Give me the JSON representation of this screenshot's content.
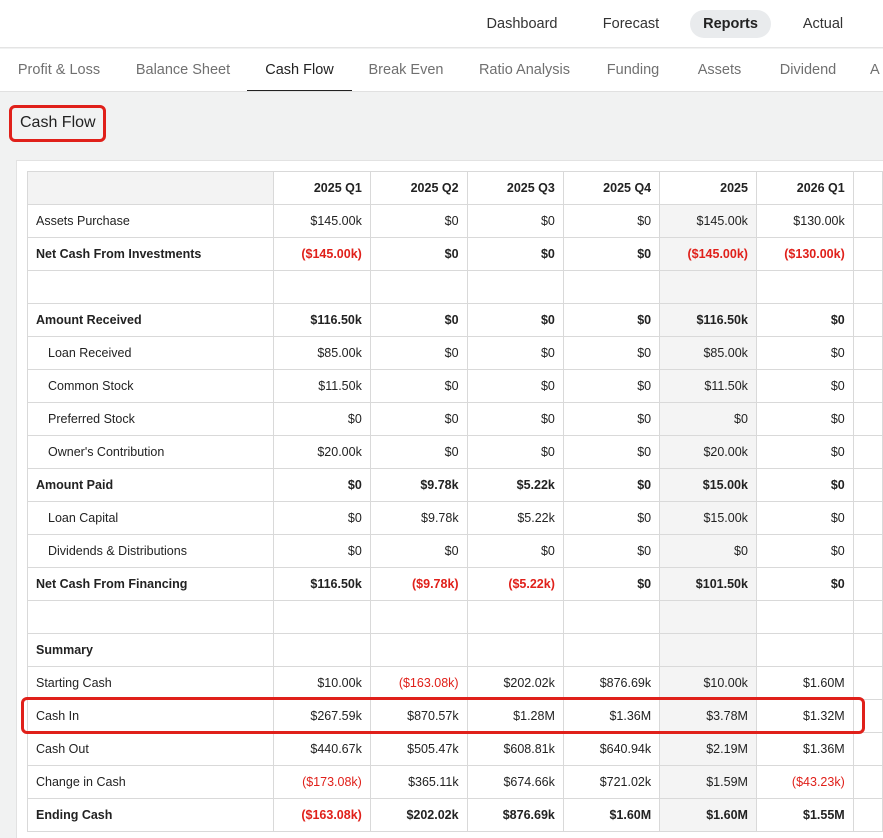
{
  "topnav": {
    "items": [
      {
        "label": "Dashboard",
        "active": false
      },
      {
        "label": "Forecast",
        "active": false
      },
      {
        "label": "Reports",
        "active": true
      },
      {
        "label": "Actual",
        "active": false
      }
    ]
  },
  "subtabs": {
    "items": [
      {
        "label": "Profit & Loss",
        "active": false
      },
      {
        "label": "Balance Sheet",
        "active": false
      },
      {
        "label": "Cash Flow",
        "active": true
      },
      {
        "label": "Break Even",
        "active": false
      },
      {
        "label": "Ratio Analysis",
        "active": false
      },
      {
        "label": "Funding",
        "active": false
      },
      {
        "label": "Assets",
        "active": false
      },
      {
        "label": "Dividend",
        "active": false
      },
      {
        "label": "A",
        "active": false
      }
    ]
  },
  "page": {
    "title": "Cash Flow"
  },
  "colors": {
    "negative": "#e0201a",
    "highlight": "#e0201a",
    "active_pill": "#e9ebed"
  },
  "table": {
    "headers": [
      "",
      "2025 Q1",
      "2025 Q2",
      "2025 Q3",
      "2025 Q4",
      "2025",
      "2026 Q1",
      ""
    ],
    "rows": [
      {
        "label": "Assets Purchase",
        "bold": false,
        "sub": false,
        "values": [
          "$145.00k",
          "$0",
          "$0",
          "$0",
          "$145.00k",
          "$130.00k"
        ],
        "neg": []
      },
      {
        "label": "Net Cash From Investments",
        "bold": true,
        "sub": false,
        "values": [
          "($145.00k)",
          "$0",
          "$0",
          "$0",
          "($145.00k)",
          "($130.00k)"
        ],
        "neg": [
          0,
          4,
          5
        ]
      },
      {
        "label": "",
        "bold": false,
        "sub": false,
        "values": [
          "",
          "",
          "",
          "",
          "",
          ""
        ],
        "neg": []
      },
      {
        "label": "Amount Received",
        "bold": true,
        "sub": false,
        "values": [
          "$116.50k",
          "$0",
          "$0",
          "$0",
          "$116.50k",
          "$0"
        ],
        "neg": []
      },
      {
        "label": "Loan Received",
        "bold": false,
        "sub": true,
        "values": [
          "$85.00k",
          "$0",
          "$0",
          "$0",
          "$85.00k",
          "$0"
        ],
        "neg": []
      },
      {
        "label": "Common Stock",
        "bold": false,
        "sub": true,
        "values": [
          "$11.50k",
          "$0",
          "$0",
          "$0",
          "$11.50k",
          "$0"
        ],
        "neg": []
      },
      {
        "label": "Preferred Stock",
        "bold": false,
        "sub": true,
        "values": [
          "$0",
          "$0",
          "$0",
          "$0",
          "$0",
          "$0"
        ],
        "neg": []
      },
      {
        "label": "Owner's Contribution",
        "bold": false,
        "sub": true,
        "values": [
          "$20.00k",
          "$0",
          "$0",
          "$0",
          "$20.00k",
          "$0"
        ],
        "neg": []
      },
      {
        "label": "Amount Paid",
        "bold": true,
        "sub": false,
        "values": [
          "$0",
          "$9.78k",
          "$5.22k",
          "$0",
          "$15.00k",
          "$0"
        ],
        "neg": []
      },
      {
        "label": "Loan Capital",
        "bold": false,
        "sub": true,
        "values": [
          "$0",
          "$9.78k",
          "$5.22k",
          "$0",
          "$15.00k",
          "$0"
        ],
        "neg": []
      },
      {
        "label": "Dividends & Distributions",
        "bold": false,
        "sub": true,
        "values": [
          "$0",
          "$0",
          "$0",
          "$0",
          "$0",
          "$0"
        ],
        "neg": []
      },
      {
        "label": "Net Cash From Financing",
        "bold": true,
        "sub": false,
        "values": [
          "$116.50k",
          "($9.78k)",
          "($5.22k)",
          "$0",
          "$101.50k",
          "$0"
        ],
        "neg": [
          1,
          2
        ]
      },
      {
        "label": "",
        "bold": false,
        "sub": false,
        "values": [
          "",
          "",
          "",
          "",
          "",
          ""
        ],
        "neg": []
      },
      {
        "label": "Summary",
        "bold": true,
        "sub": false,
        "values": [
          "",
          "",
          "",
          "",
          "",
          ""
        ],
        "neg": []
      },
      {
        "label": "Starting Cash",
        "bold": false,
        "sub": false,
        "values": [
          "$10.00k",
          "($163.08k)",
          "$202.02k",
          "$876.69k",
          "$10.00k",
          "$1.60M"
        ],
        "neg": [
          1
        ]
      },
      {
        "label": "Cash In",
        "bold": false,
        "sub": false,
        "values": [
          "$267.59k",
          "$870.57k",
          "$1.28M",
          "$1.36M",
          "$3.78M",
          "$1.32M"
        ],
        "neg": []
      },
      {
        "label": "Cash Out",
        "bold": false,
        "sub": false,
        "values": [
          "$440.67k",
          "$505.47k",
          "$608.81k",
          "$640.94k",
          "$2.19M",
          "$1.36M"
        ],
        "neg": []
      },
      {
        "label": "Change in Cash",
        "bold": false,
        "sub": false,
        "values": [
          "($173.08k)",
          "$365.11k",
          "$674.66k",
          "$721.02k",
          "$1.59M",
          "($43.23k)"
        ],
        "neg": [
          0,
          5
        ]
      },
      {
        "label": "Ending Cash",
        "bold": true,
        "sub": false,
        "values": [
          "($163.08k)",
          "$202.02k",
          "$876.69k",
          "$1.60M",
          "$1.60M",
          "$1.55M"
        ],
        "neg": [
          0
        ]
      }
    ]
  }
}
